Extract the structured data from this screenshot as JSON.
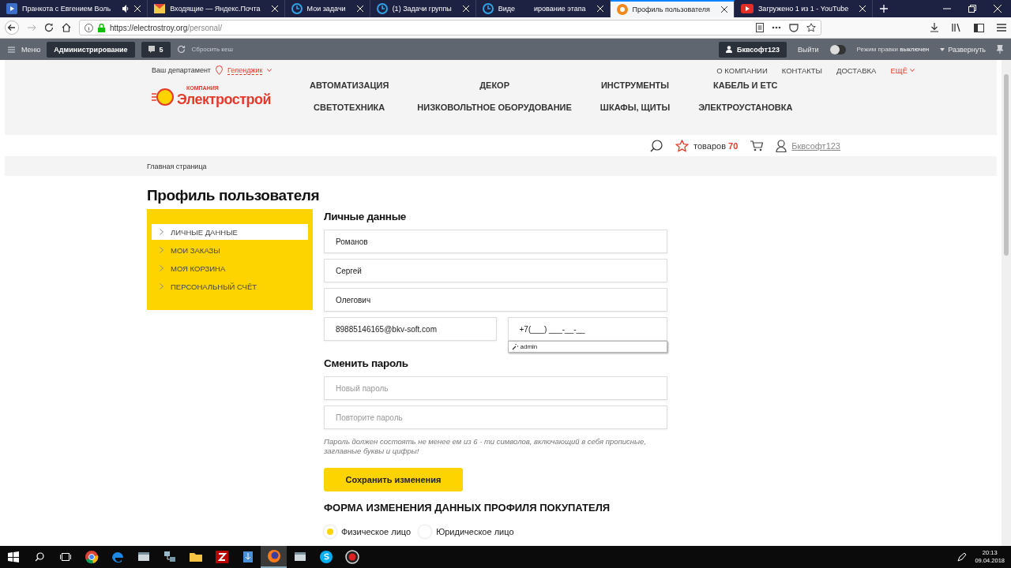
{
  "browser": {
    "tabs": [
      {
        "title": "Пранкота с Евгением Воль",
        "kind": "video",
        "audio": true,
        "selected": false
      },
      {
        "title": "Входящие — Яндекс.Почта",
        "kind": "mail",
        "audio": false,
        "selected": false
      },
      {
        "title": "Мои задачи",
        "kind": "b24",
        "audio": false,
        "selected": false
      },
      {
        "title": "(1) Задачи группы",
        "kind": "b24",
        "audio": false,
        "selected": false
      },
      {
        "title": "Виде",
        "title_end": "ирование этапа",
        "kind": "b24",
        "audio": false,
        "selected": false
      },
      {
        "title": "Профиль пользователя",
        "kind": "site",
        "audio": false,
        "selected": true
      },
      {
        "title": "Загружено 1 из 1 - YouTube",
        "kind": "youtube",
        "audio": false,
        "selected": false
      }
    ],
    "url_host": "https://electrostroy.org",
    "url_path": "/personal/"
  },
  "admin_bar": {
    "menu": "Меню",
    "admin": "Администрирование",
    "count": "5",
    "reset": "Сбросить кеш",
    "user": "Бквсофт123",
    "logout": "Выйти",
    "edit_mode": {
      "label": "Режим правки",
      "state": "выключен",
      "on": false
    },
    "expand": "Развернуть"
  },
  "header": {
    "dept_label": "Ваш департамент",
    "city": "Геленджик",
    "top_links": [
      "О КОМПАНИИ",
      "КОНТАКТЫ",
      "ДОСТАВКА"
    ],
    "more": "ЕЩЁ",
    "logo": {
      "small": "КОМПАНИЯ",
      "big": "Электрострой"
    },
    "nav": [
      [
        "АВТОМАТИЗАЦИЯ",
        "ДЕКОР",
        "ИНСТРУМЕНТЫ",
        "КАБЕЛЬ И ЕТС"
      ],
      [
        "СВЕТОТЕХНИКА",
        "НИЗКОВОЛЬТНОЕ ОБОРУДОВАНИЕ",
        "ШКАФЫ, ЩИТЫ",
        "ЭЛЕКТРОУСТАНОВКА"
      ]
    ],
    "fav_label": "товаров",
    "fav_count": "70",
    "user": "Бквсофт123"
  },
  "breadcrumb": "Главная страница",
  "title": "Профиль пользователя",
  "sidebar": [
    {
      "label": "ЛИЧНЫЕ ДАННЫЕ",
      "selected": true
    },
    {
      "label": "МОИ ЗАКАЗЫ",
      "selected": false
    },
    {
      "label": "МОЯ КОРЗИНА",
      "selected": false
    },
    {
      "label": "ПЕРСОНАЛЬНЫЙ СЧЁТ",
      "selected": false
    }
  ],
  "personal": {
    "heading": "Личные данные",
    "last_name": "Романов",
    "first_name": "Сергей",
    "middle_name": "Олегович",
    "email": "89885146165@bkv-soft.com",
    "phone": "+7(___) ___-__-__",
    "autocomplete": "admin"
  },
  "password": {
    "heading": "Сменить пароль",
    "new_placeholder": "Новый пароль",
    "repeat_placeholder": "Повторите пароль",
    "hint": "Пароль должен состоять не менее ем из 6 - ти символов, включающий в себя прописные, заглавные буквы и цифры!",
    "save": "Сохранить изменения"
  },
  "buyer_form": {
    "heading": "ФОРМА ИЗМЕНЕНИЯ ДАННЫХ ПРОФИЛЯ ПОКУПАТЕЛЯ",
    "options": [
      {
        "label": "Физическое лицо",
        "selected": true
      },
      {
        "label": "Юридическое лицо",
        "selected": false
      }
    ]
  },
  "taskbar": {
    "apps": [
      {
        "kind": "chrome",
        "active": false
      },
      {
        "kind": "edge",
        "active": false
      },
      {
        "kind": "app",
        "active": false
      },
      {
        "kind": "network",
        "active": false
      },
      {
        "kind": "folder",
        "active": false
      },
      {
        "kind": "filezilla",
        "active": false
      },
      {
        "kind": "download",
        "active": false
      },
      {
        "kind": "firefox",
        "active": true
      },
      {
        "kind": "app",
        "active": false
      },
      {
        "kind": "skype",
        "active": false
      },
      {
        "kind": "record",
        "active": false
      }
    ],
    "time": "20:13",
    "date": "09.04.2018"
  }
}
